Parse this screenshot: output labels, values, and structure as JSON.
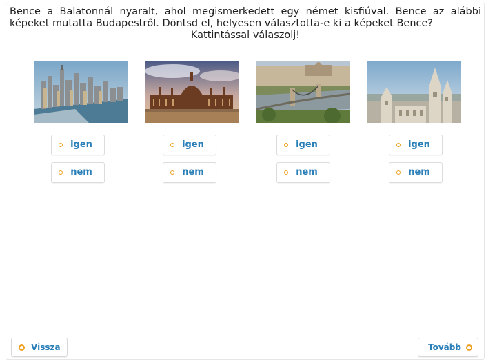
{
  "instructions": {
    "line1": "Bence a Balatonnál nyaralt, ahol megismerkedett egy német kisfiúval. Bence az alábbi",
    "line2": "képeket mutatta Budapestről. Döntsd el, helyesen választotta-e ki a képeket Bence?",
    "line3": "Kattintással válaszolj!"
  },
  "photos": [
    {
      "icon": "city-skyline-photo"
    },
    {
      "icon": "parliament-photo"
    },
    {
      "icon": "chain-bridge-photo"
    },
    {
      "icon": "fishermens-bastion-photo"
    }
  ],
  "answers": {
    "yes_label": "igen",
    "no_label": "nem"
  },
  "nav": {
    "back_label": "Vissza",
    "next_label": "Tovább"
  },
  "colors": {
    "accent": "#f0a020",
    "label_blue": "#2a7fb8"
  }
}
